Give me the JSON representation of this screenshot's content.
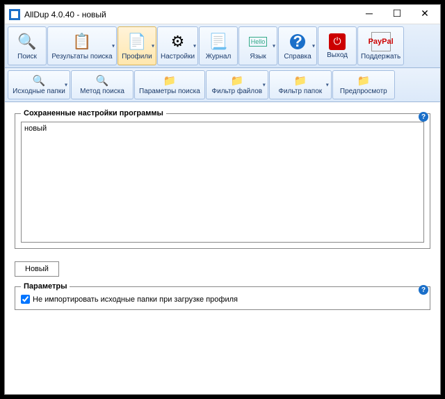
{
  "window": {
    "title": "AllDup 4.0.40 - новый"
  },
  "toolbar_main": [
    {
      "label": "Поиск",
      "icon": "🔍"
    },
    {
      "label": "Результаты поиска",
      "icon": "📋",
      "dd": true,
      "wide": true
    },
    {
      "label": "Профили",
      "icon": "📄",
      "dd": true,
      "active": true
    },
    {
      "label": "Настройки",
      "icon": "⚙",
      "dd": true
    },
    {
      "label": "Журнал",
      "icon": "📃"
    },
    {
      "label": "Язык",
      "icon": "Hello",
      "dd": true
    },
    {
      "label": "Справка",
      "icon": "?",
      "dd": true
    },
    {
      "label": "Выход",
      "icon": "⏻"
    },
    {
      "label": "Поддержать",
      "icon": "PayPal"
    }
  ],
  "toolbar_sub": [
    {
      "label": "Исходные папки",
      "icon": "🔍",
      "dd": true
    },
    {
      "label": "Метод поиска",
      "icon": "🔍"
    },
    {
      "label": "Параметры поиска",
      "icon": "📁"
    },
    {
      "label": "Фильтр файлов",
      "icon": "📁",
      "dd": true
    },
    {
      "label": "Фильтр папок",
      "icon": "📁",
      "dd": true
    },
    {
      "label": "Предпросмотр",
      "icon": "📁"
    }
  ],
  "group1": {
    "legend": "Сохраненные настройки программы",
    "items": [
      "новый"
    ],
    "new_button": "Новый"
  },
  "group2": {
    "legend": "Параметры",
    "checkbox_label": "Не импортировать исходные папки при загрузке профиля",
    "checked": true
  }
}
